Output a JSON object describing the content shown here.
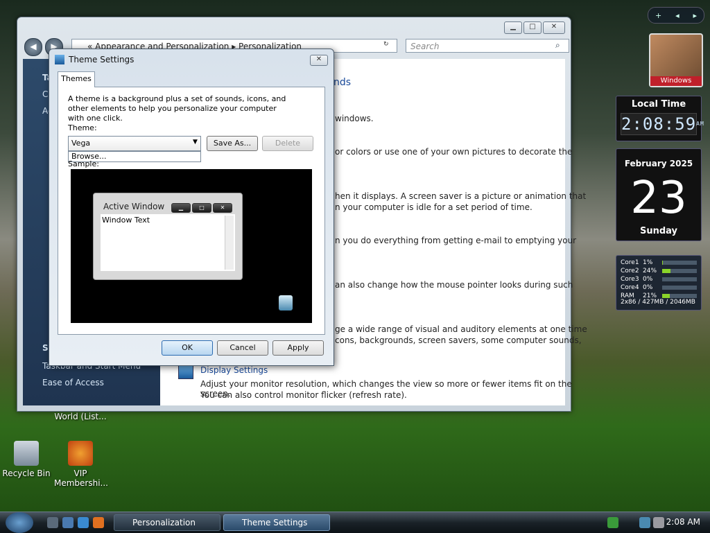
{
  "desktop": {
    "icons": [
      {
        "label": "Recycle Bin"
      },
      {
        "label": "VIP Membershi..."
      },
      {
        "label": "World (List..."
      }
    ]
  },
  "explorer": {
    "address": "« Appearance and Personalization ▸ Personalization",
    "search_placeholder": "Search",
    "sidebar": {
      "items": [
        "Ta",
        "Cl",
        "Ad",
        "Se",
        "Taskbar and Start Menu",
        "Ease of Access"
      ]
    },
    "content": {
      "heading_fragment": "nds",
      "paragraphs": [
        "windows.",
        "or colors or use one of your own pictures to decorate the",
        "hen it displays. A screen saver is a picture or animation that",
        "n your computer is idle for a set period of time.",
        "n you do everything from getting e-mail to emptying your",
        "an also change how the mouse pointer looks during such",
        "ge a wide range of visual and auditory elements at one time",
        "cons, backgrounds, screen savers, some computer sounds,"
      ],
      "display_settings_link": "Display Settings",
      "display_settings_desc_1": "Adjust your monitor resolution, which changes the view so more or fewer items fit on the screen.",
      "display_settings_desc_2": "You can also control monitor flicker (refresh rate)."
    }
  },
  "dialog": {
    "title": "Theme Settings",
    "tab": "Themes",
    "description": "A theme is a background plus a set of sounds, icons, and other elements to help you personalize your computer with one click.",
    "theme_label": "Theme:",
    "theme_value": "Vega",
    "dropdown_option": "Browse...",
    "save_as": "Save As...",
    "delete": "Delete",
    "sample_label": "Sample:",
    "preview": {
      "active_window": "Active Window",
      "window_text": "Window Text"
    },
    "ok": "OK",
    "cancel": "Cancel",
    "apply": "Apply"
  },
  "gadgets": {
    "picture_label": "Windows",
    "clock_title": "Local Time",
    "clock_time": "2:08:59",
    "clock_ampm": "AM",
    "calendar_month": "February 2025",
    "calendar_day": "23",
    "calendar_weekday": "Sunday",
    "cpu": [
      {
        "name": "Core1",
        "pct": "1%",
        "value": 1
      },
      {
        "name": "Core2",
        "pct": "24%",
        "value": 24
      },
      {
        "name": "Core3",
        "pct": "0%",
        "value": 0
      },
      {
        "name": "Core4",
        "pct": "0%",
        "value": 0
      },
      {
        "name": "RAM",
        "pct": "21%",
        "value": 21
      }
    ],
    "memory": "2x86 / 427MB / 2046MB"
  },
  "taskbar": {
    "tasks": [
      "Personalization",
      "Theme Settings"
    ],
    "time": "2:08 AM"
  },
  "colors": {
    "accent": "#1a4a9a",
    "cpu_bar": "#8ad42a",
    "picture_label_bg": "#c0202a"
  }
}
